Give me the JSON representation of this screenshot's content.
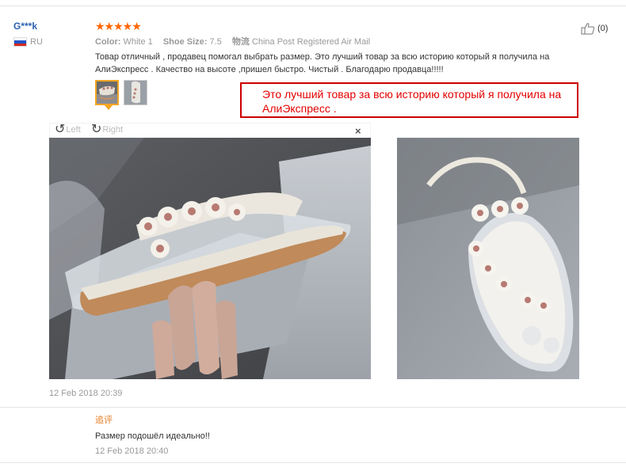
{
  "review": {
    "username": "G***k",
    "country": "RU",
    "stars": "★★★★★",
    "attributes": [
      {
        "key": "Color:",
        "value": "White 1"
      },
      {
        "key": "Shoe Size:",
        "value": "7.5"
      },
      {
        "key": "物流",
        "value": "China Post Registered Air Mail"
      }
    ],
    "helpful_count": "(0)",
    "text": "Товар отличный , продавец помогал выбрать размер. Это лучший товар за всю историю который я получила на АлиЭкспресс . Качество на высоте ,пришел быстро. Чистый . Благодарю продавца!!!!!",
    "annotation": "Это лучший товар за всю историю который я получила на АлиЭкспресс .",
    "viewer": {
      "rotate_left": "Left",
      "rotate_right": "Right",
      "close": "×"
    },
    "date": "12 Feb 2018 20:39"
  },
  "followup": {
    "label": "追评",
    "text": "Размер подошёл идеально!!",
    "date": "12 Feb 2018 20:40"
  },
  "colors": {
    "username": "#2c62b3",
    "stars": "#ff6600",
    "annotation_border": "#cc0000",
    "annotation_text": "#e30000",
    "followup_label": "#e67e22"
  }
}
